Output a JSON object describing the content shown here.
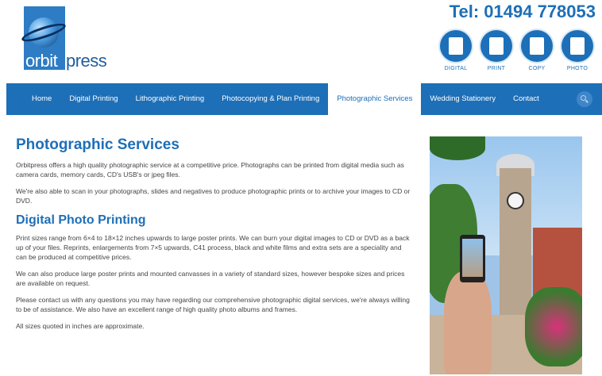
{
  "header": {
    "logo_text_1": "orbit",
    "logo_text_2": "press",
    "tel": "Tel: 01494 778053",
    "services": [
      {
        "label": "DIGITAL",
        "icon": "digital-icon"
      },
      {
        "label": "PRINT",
        "icon": "print-icon"
      },
      {
        "label": "COPY",
        "icon": "copy-icon"
      },
      {
        "label": "PHOTO",
        "icon": "photo-icon"
      }
    ]
  },
  "nav": {
    "items": [
      {
        "label": "Home"
      },
      {
        "label": "Digital Printing"
      },
      {
        "label": "Lithographic Printing"
      },
      {
        "label": "Photocopying & Plan Printing"
      },
      {
        "label": "Photographic Services"
      },
      {
        "label": "Wedding Stationery"
      },
      {
        "label": "Contact"
      }
    ],
    "active_index": 4
  },
  "main": {
    "title": "Photographic Services",
    "intro_paragraphs": [
      "Orbitpress offers a high quality photographic service at a competitive price. Photographs can be printed from digital media such as camera cards, memory cards, CD's  USB's or jpeg files.",
      "We're also able to scan in your photographs, slides and negatives to produce photographic prints or to archive your images to CD or DVD."
    ],
    "subtitle": "Digital Photo Printing",
    "body_paragraphs": [
      "Print sizes range from 6×4 to 18×12 inches upwards to large poster prints. We can burn your digital images to CD or DVD as a back up of your files. Reprints, enlargements from 7×5 upwards, C41 process, black and white films and extra sets are a speciality and can be produced at competitive prices.",
      "We can also produce large poster prints and mounted canvasses in a variety of standard sizes, however bespoke sizes and prices are available on request.",
      "Please contact us with any questions you may have regarding our comprehensive photographic digital services, we're always willing to be of assistance. We also have an excellent range of high quality photo albums and frames.",
      "All sizes quoted in inches are approximate."
    ]
  },
  "colors": {
    "brand_blue": "#1d6fb8",
    "nav_active_bg": "#ffffff"
  }
}
